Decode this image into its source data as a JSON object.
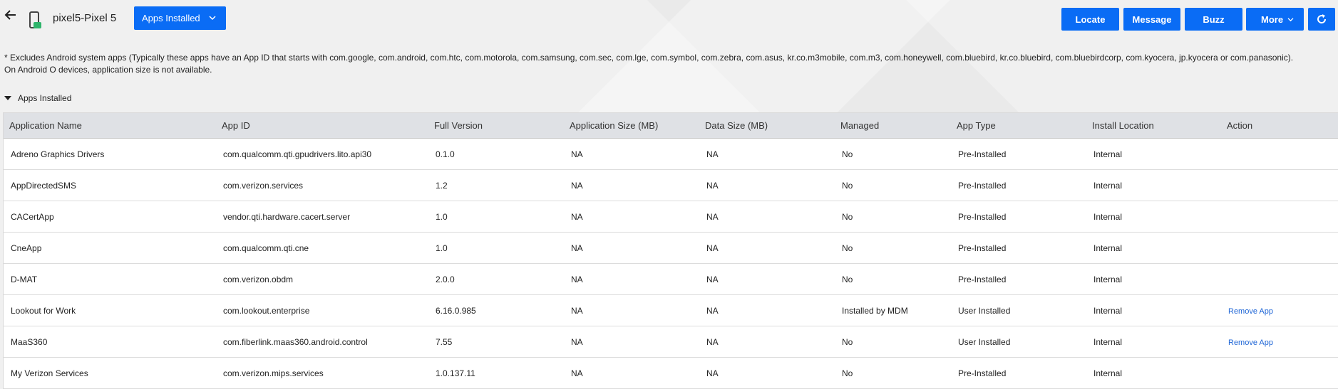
{
  "header": {
    "device_name": "pixel5-Pixel 5",
    "view_dropdown": {
      "label": "Apps Installed"
    },
    "buttons": {
      "locate": "Locate",
      "message": "Message",
      "buzz": "Buzz",
      "more": "More"
    },
    "icons": [
      "back-arrow-icon",
      "device-icon",
      "chevron-down-icon",
      "refresh-icon"
    ]
  },
  "note": {
    "line1": "* Excludes Android system apps (Typically these apps have an App ID that starts with com.google, com.android, com.htc, com.motorola, com.samsung, com.sec, com.lge, com.symbol, com.zebra, com.asus, kr.co.m3mobile, com.m3, com.honeywell, com.bluebird, kr.co.bluebird, com.bluebirdcorp, com.kyocera, jp.kyocera or com.panasonic).",
    "line2": "On Android O devices, application size is not available."
  },
  "section": {
    "title": "Apps Installed"
  },
  "table": {
    "columns": [
      "Application Name",
      "App ID",
      "Full Version",
      "Application Size (MB)",
      "Data Size (MB)",
      "Managed",
      "App Type",
      "Install Location",
      "Action"
    ],
    "rows": [
      [
        "Adreno Graphics Drivers",
        "com.qualcomm.qti.gpudrivers.lito.api30",
        "0.1.0",
        "NA",
        "NA",
        "No",
        "Pre-Installed",
        "Internal",
        ""
      ],
      [
        "AppDirectedSMS",
        "com.verizon.services",
        "1.2",
        "NA",
        "NA",
        "No",
        "Pre-Installed",
        "Internal",
        ""
      ],
      [
        "CACertApp",
        "vendor.qti.hardware.cacert.server",
        "1.0",
        "NA",
        "NA",
        "No",
        "Pre-Installed",
        "Internal",
        ""
      ],
      [
        "CneApp",
        "com.qualcomm.qti.cne",
        "1.0",
        "NA",
        "NA",
        "No",
        "Pre-Installed",
        "Internal",
        ""
      ],
      [
        "D-MAT",
        "com.verizon.obdm",
        "2.0.0",
        "NA",
        "NA",
        "No",
        "Pre-Installed",
        "Internal",
        ""
      ],
      [
        "Lookout for Work",
        "com.lookout.enterprise",
        "6.16.0.985",
        "NA",
        "NA",
        "Installed by MDM",
        "User Installed",
        "Internal",
        "Remove App"
      ],
      [
        "MaaS360",
        "com.fiberlink.maas360.android.control",
        "7.55",
        "NA",
        "NA",
        "No",
        "User Installed",
        "Internal",
        "Remove App"
      ],
      [
        "My Verizon Services",
        "com.verizon.mips.services",
        "1.0.137.11",
        "NA",
        "NA",
        "No",
        "Pre-Installed",
        "Internal",
        ""
      ]
    ]
  },
  "colors": {
    "accent": "#0a6cf5",
    "link": "#1f66d6",
    "header_bg": "#dfe1e5",
    "device_icon_green": "#2fb46b"
  }
}
